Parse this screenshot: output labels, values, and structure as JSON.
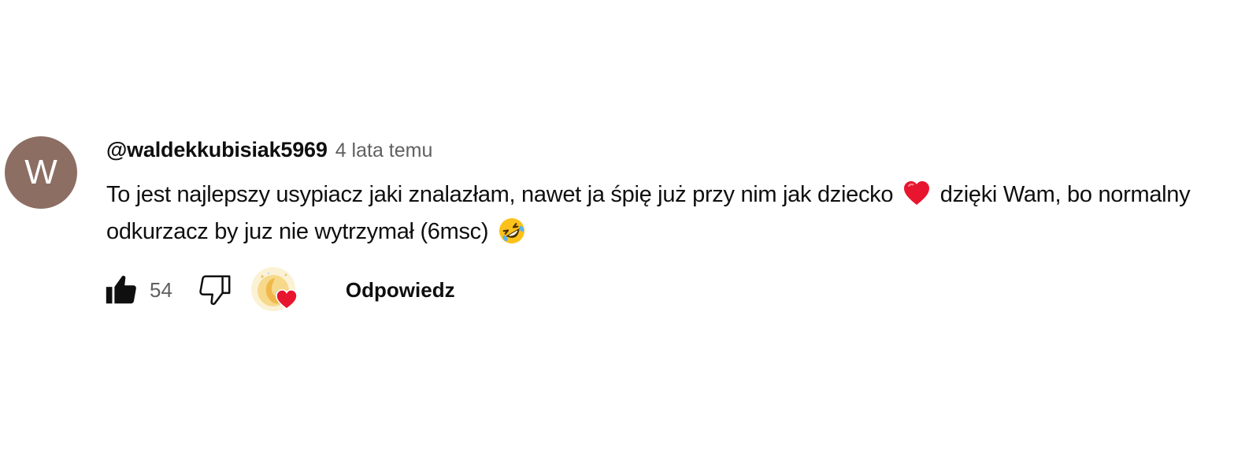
{
  "comment": {
    "avatar_letter": "W",
    "avatar_color": "#8d6e63",
    "author": "@waldekkubisiak5969",
    "timestamp": "4 lata temu",
    "text_part1": "To jest najlepszy usypiacz jaki znalazłam, nawet ja śpię już przy nim jak dziecko",
    "emoji1": "red-heart-emoji",
    "text_part2": "dzięki Wam, bo normalny odkurzacz by juz nie wytrzymał (6msc)",
    "emoji2": "rolling-on-floor-laughing-emoji"
  },
  "actions": {
    "like_icon": "thumbs-up-filled-icon",
    "like_count": "54",
    "dislike_icon": "thumbs-down-outline-icon",
    "creator_heart_icon": "creator-heart-icon",
    "reply_label": "Odpowiedz"
  },
  "colors": {
    "text": "#0f0f0f",
    "secondary_text": "#606060",
    "heart": "#e8152f"
  }
}
